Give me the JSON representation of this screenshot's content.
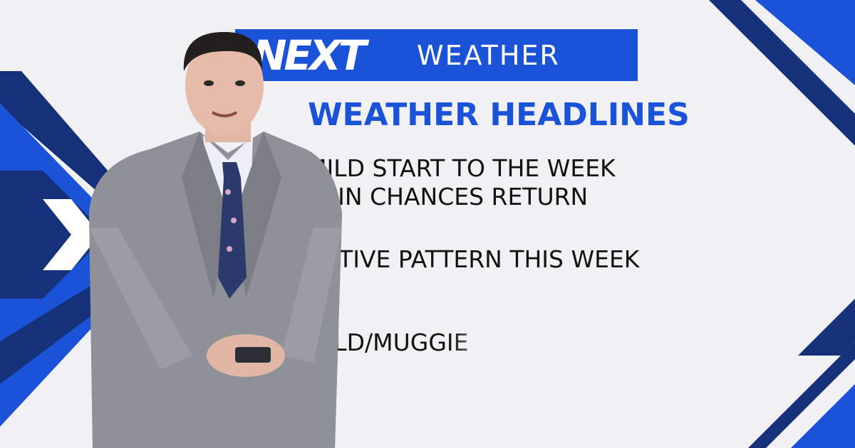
{
  "brand": {
    "logo_text": "NEXT",
    "label": "WEATHER"
  },
  "headlines": {
    "title": "WEATHER HEADLINES",
    "items": [
      "MILD START TO THE WEEK",
      "RAIN CHANCES RETURN",
      "ACTIVE PATTERN THIS WEEK",
      "MILD/MUGGIE"
    ]
  },
  "colors": {
    "brand_blue": "#1a52d8",
    "navy": "#15317a",
    "background": "#f1f1f3",
    "text": "#111111"
  },
  "people": {
    "presenter": "meteorologist in grey suit holding clicker"
  }
}
